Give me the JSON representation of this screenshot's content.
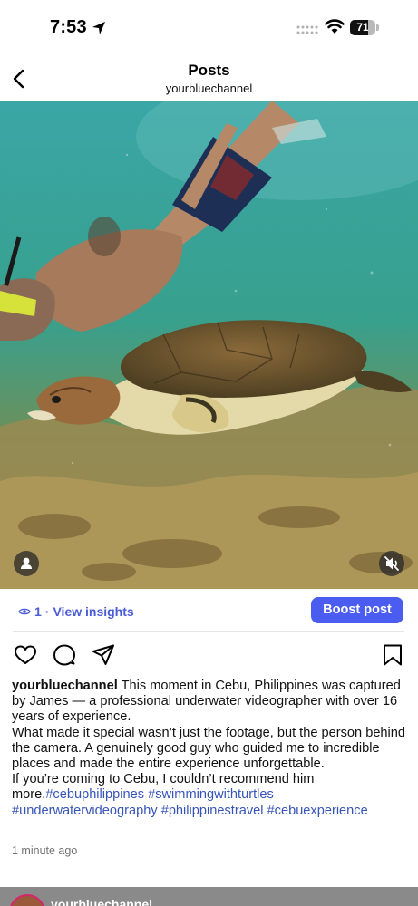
{
  "status_bar": {
    "time": "7:53",
    "battery": "71",
    "battery_level": 0.71
  },
  "header": {
    "title": "Posts",
    "subtitle": "yourbluechannel"
  },
  "insights": {
    "count": "1",
    "separator": "·",
    "link": "View insights"
  },
  "boost": {
    "label": "Boost post"
  },
  "icons": {
    "back": "chevron-left-icon",
    "location": "location-arrow-icon",
    "signal": "cellular-signal-icon",
    "wifi": "wifi-icon",
    "tag": "person-tag-icon",
    "mute": "muted-speaker-icon",
    "eye": "eye-icon",
    "like": "heart-icon",
    "comment": "comment-icon",
    "share": "paper-plane-icon",
    "save": "bookmark-icon"
  },
  "colors": {
    "accent": "#4a5df0",
    "link": "#4a5bd6",
    "hashtag": "#3654b8"
  },
  "caption": {
    "username": "yourbluechannel",
    "p1": "This moment in Cebu, Philippines was captured by James — a professional underwater videographer with over 16 years of experience.",
    "p2": "What made it special wasn’t just the footage, but the person behind the camera. A genuinely good guy who guided me to incredible places and made the entire experience unforgettable.",
    "p3": "If you’re coming to Cebu, I couldn’t recommend him more.",
    "hashtags": [
      "#cebuphilippines",
      "#swimmingwithturtles",
      "#underwatervideography",
      "#philippinestravel",
      "#cebuexperience"
    ]
  },
  "timestamp": "1 minute ago",
  "next_post": {
    "username": "yourbluechannel"
  }
}
